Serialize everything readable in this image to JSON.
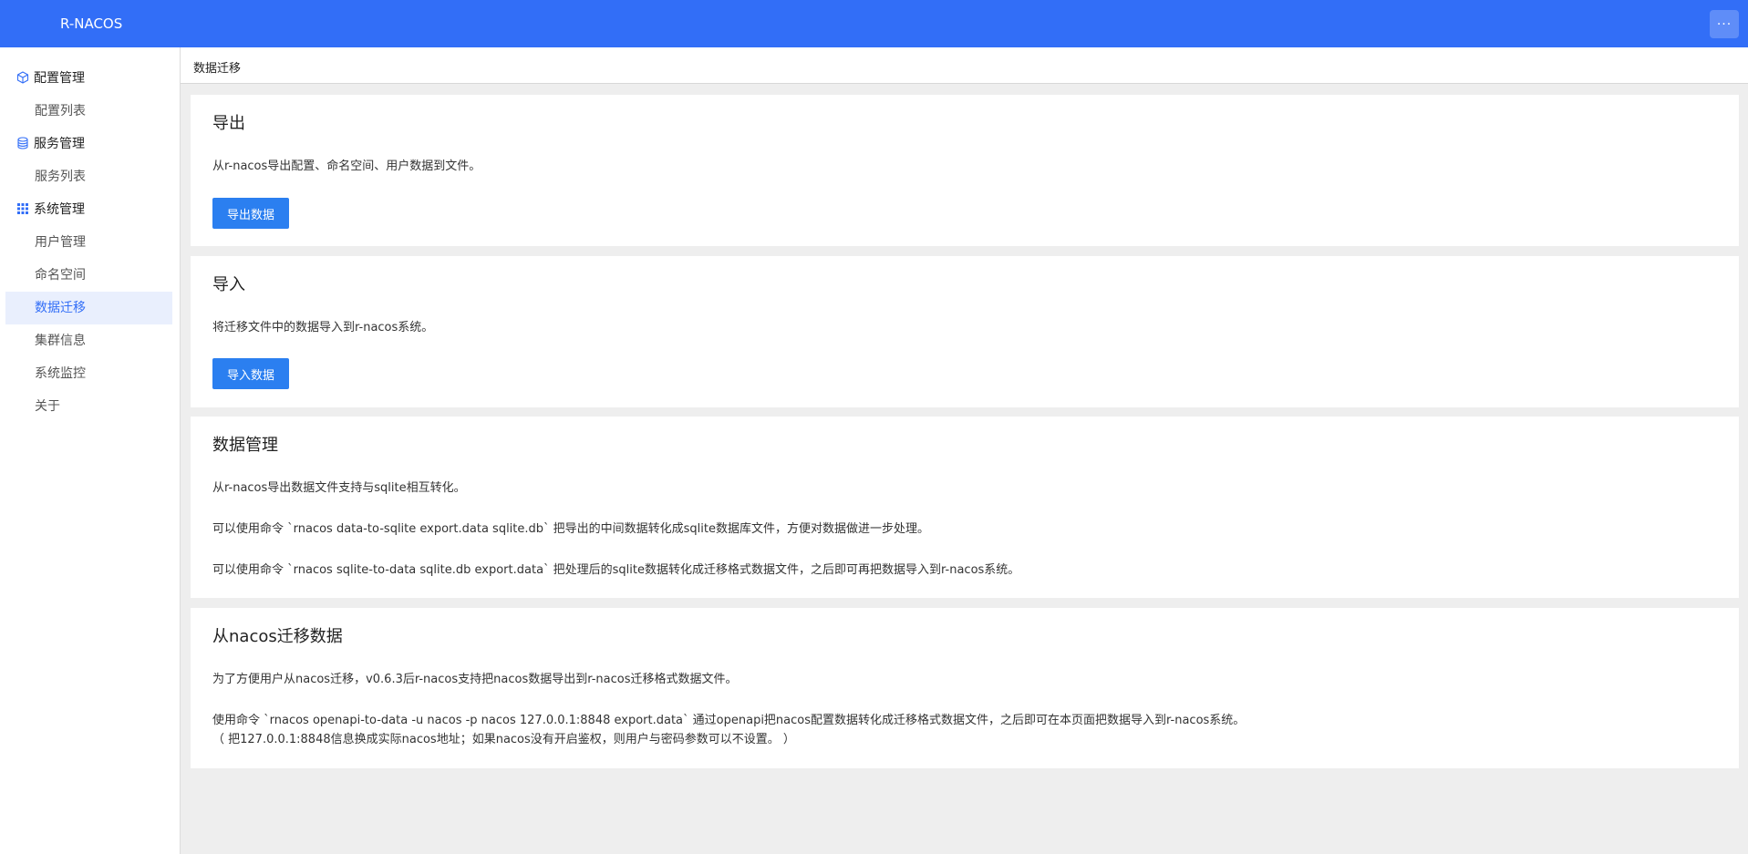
{
  "header": {
    "brand": "R-NACOS",
    "more_icon": "more-horizontal-icon",
    "more_label": "···"
  },
  "sidebar": {
    "groups": [
      {
        "label": "配置管理",
        "icon": "cube-icon",
        "items": [
          {
            "label": "配置列表"
          }
        ]
      },
      {
        "label": "服务管理",
        "icon": "database-icon",
        "items": [
          {
            "label": "服务列表"
          }
        ]
      },
      {
        "label": "系统管理",
        "icon": "grid-icon",
        "items": [
          {
            "label": "用户管理"
          },
          {
            "label": "命名空间"
          },
          {
            "label": "数据迁移",
            "active": true
          },
          {
            "label": "集群信息"
          },
          {
            "label": "系统监控"
          },
          {
            "label": "关于"
          }
        ]
      }
    ]
  },
  "breadcrumb": {
    "current": "数据迁移"
  },
  "sections": {
    "export": {
      "title": "导出",
      "text": "从r-nacos导出配置、命名空间、用户数据到文件。",
      "button": "导出数据"
    },
    "import": {
      "title": "导入",
      "text": "将迁移文件中的数据导入到r-nacos系统。",
      "button": "导入数据"
    },
    "data_management": {
      "title": "数据管理",
      "lines": [
        "从r-nacos导出数据文件支持与sqlite相互转化。",
        "可以使用命令 `rnacos data-to-sqlite export.data sqlite.db` 把导出的中间数据转化成sqlite数据库文件，方便对数据做进一步处理。",
        "可以使用命令 `rnacos sqlite-to-data sqlite.db export.data` 把处理后的sqlite数据转化成迁移格式数据文件，之后即可再把数据导入到r-nacos系统。"
      ]
    },
    "nacos_migration": {
      "title": "从nacos迁移数据",
      "lines": [
        "为了方便用户从nacos迁移，v0.6.3后r-nacos支持把nacos数据导出到r-nacos迁移格式数据文件。",
        "使用命令 `rnacos openapi-to-data -u nacos -p nacos 127.0.0.1:8848 export.data` 通过openapi把nacos配置数据转化成迁移格式数据文件，之后即可在本页面把数据导入到r-nacos系统。",
        "（ 把127.0.0.1:8848信息换成实际nacos地址；如果nacos没有开启鉴权，则用户与密码参数可以不设置。 ）"
      ]
    }
  },
  "colors": {
    "topbar": "#326ef7",
    "primary_button": "#2b7ff0",
    "active_menu_bg": "#e9effd",
    "page_bg": "#eeeeee"
  }
}
